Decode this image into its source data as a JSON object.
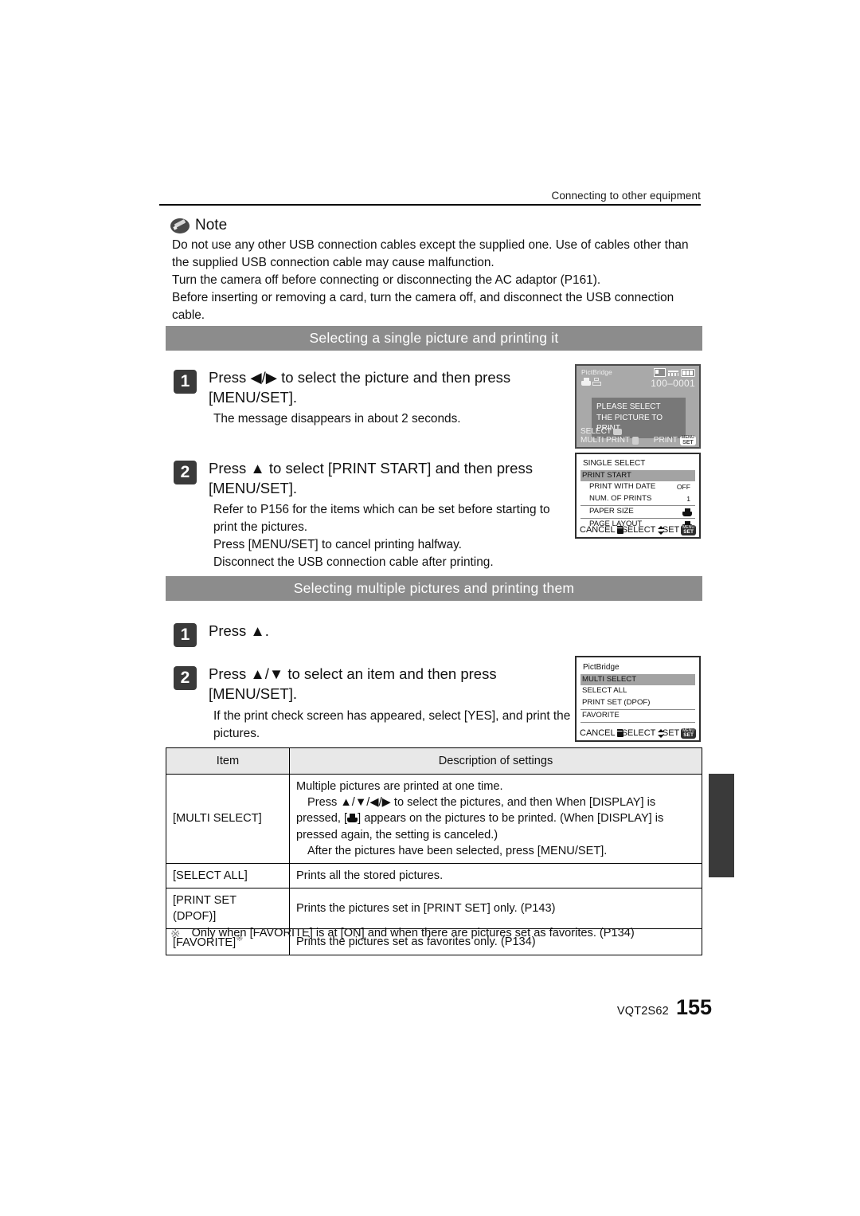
{
  "header": {
    "running_head": "Connecting to other equipment"
  },
  "note": {
    "label": "Note",
    "lines": [
      "Do not use any other USB connection cables except the supplied one. Use of cables other than the supplied USB connection cable may cause malfunction.",
      "Turn the camera off before connecting or disconnecting the AC adaptor (P161).",
      "Before inserting or removing a card, turn the camera off, and disconnect the USB connection cable."
    ]
  },
  "sections": [
    {
      "title": "Selecting a single picture and printing it",
      "steps": [
        {
          "num": "1",
          "heading": "Press ◀/▶ to select the picture and then press [MENU/SET].",
          "sub": [
            "The message disappears in about 2 seconds."
          ]
        },
        {
          "num": "2",
          "heading": "Press ▲ to select [PRINT START] and then press [MENU/SET].",
          "sub": [
            "Refer to P156 for the items which can be set before starting to print the pictures.",
            "Press [MENU/SET] to cancel printing halfway.",
            "Disconnect the USB connection cable after printing."
          ]
        }
      ]
    },
    {
      "title": "Selecting multiple pictures and printing them",
      "steps": [
        {
          "num": "1",
          "heading": "Press ▲.",
          "sub": []
        },
        {
          "num": "2",
          "heading": "Press ▲/▼ to select an item and then press [MENU/SET].",
          "sub": [
            "If the print check screen has appeared, select [YES], and print the pictures."
          ]
        }
      ]
    }
  ],
  "lcd_single_picture": {
    "title": "PictBridge",
    "file_number": "100–0001",
    "message_line1": "PLEASE SELECT",
    "message_line2": "THE PICTURE TO PRINT",
    "footer_select": "SELECT",
    "footer_multi_print": "MULTI PRINT",
    "footer_print": "PRINT",
    "menu_set_btn_top": "MENU",
    "menu_set_btn_bottom": "SET"
  },
  "lcd_single_select": {
    "title": "SINGLE SELECT",
    "rows": [
      {
        "label": "PRINT START",
        "value": "",
        "selected": true,
        "indent": false,
        "icon": ""
      },
      {
        "label": "PRINT WITH DATE",
        "value": "OFF",
        "selected": false,
        "indent": true,
        "icon": ""
      },
      {
        "label": "NUM. OF PRINTS",
        "value": "1",
        "selected": false,
        "indent": true,
        "icon": ""
      },
      {
        "label": "PAPER SIZE",
        "value": "",
        "selected": false,
        "indent": true,
        "icon": "printer-icon"
      },
      {
        "label": "PAGE LAYOUT",
        "value": "",
        "selected": false,
        "indent": true,
        "icon": "printer-icon"
      }
    ],
    "footer_cancel": "CANCEL",
    "footer_select": "SELECT",
    "footer_set": "SET",
    "menu_set_btn_top": "MENU",
    "menu_set_btn_bottom": "SET"
  },
  "lcd_multi_select": {
    "title": "PictBridge",
    "rows": [
      {
        "label": "MULTI SELECT",
        "selected": true
      },
      {
        "label": "SELECT ALL",
        "selected": false
      },
      {
        "label": "PRINT SET (DPOF)",
        "selected": false
      },
      {
        "label": "FAVORITE",
        "selected": false
      }
    ],
    "footer_cancel": "CANCEL",
    "footer_select": "SELECT",
    "footer_set": "SET",
    "menu_set_btn_top": "MENU",
    "menu_set_btn_bottom": "SET"
  },
  "table": {
    "headers": [
      "Item",
      "Description of settings"
    ],
    "rows": [
      {
        "item": "[MULTI SELECT]",
        "item_sup": "",
        "desc_lines": [
          {
            "text": "Multiple pictures are printed at one time.",
            "indent": false,
            "has_icon": false
          },
          {
            "text": "Press ▲/▼/◀/▶ to select the pictures, and then When [DISPLAY] is",
            "indent": true,
            "has_icon": false
          },
          {
            "text_before": "pressed, [",
            "text_after": "] appears on the pictures to be printed. (When [DISPLAY] is",
            "indent": false,
            "has_icon": true
          },
          {
            "text": "pressed again, the setting is canceled.)",
            "indent": false,
            "has_icon": false
          },
          {
            "text": "After the pictures have been selected, press [MENU/SET].",
            "indent": true,
            "has_icon": false
          }
        ]
      },
      {
        "item": "[SELECT ALL]",
        "item_sup": "",
        "desc_lines": [
          {
            "text": "Prints all the stored pictures.",
            "indent": false,
            "has_icon": false
          }
        ]
      },
      {
        "item": "[PRINT SET (DPOF)]",
        "item_sup": "",
        "desc_lines": [
          {
            "text": "Prints the pictures set in [PRINT SET] only. (P143)",
            "indent": false,
            "has_icon": false
          }
        ]
      },
      {
        "item": "[FAVORITE]",
        "item_sup": "※",
        "desc_lines": [
          {
            "text": "Prints the pictures set as favorites only. (P134)",
            "indent": false,
            "has_icon": false
          }
        ]
      }
    ]
  },
  "footnote": {
    "marker": "※",
    "text": "Only when [FAVORITE] is at [ON] and when there are pictures set as favorites. (P134)"
  },
  "page_footer": {
    "code": "VQT2S62",
    "number": "155"
  }
}
